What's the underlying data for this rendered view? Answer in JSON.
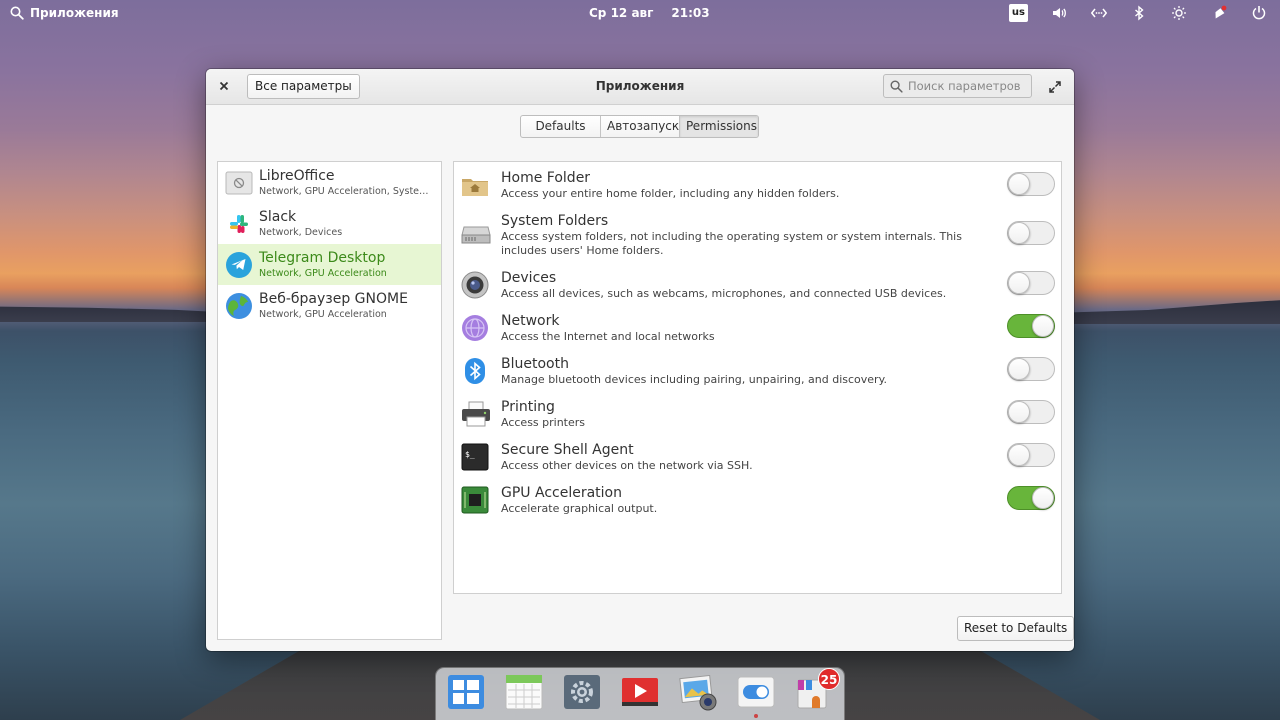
{
  "top_panel": {
    "apps_label": "Приложения",
    "date": "Ср 12 авг",
    "time": "21:03",
    "keyboard_layout": "us"
  },
  "window": {
    "title": "Приложения",
    "all_settings_label": "Все параметры",
    "search_placeholder": "Поиск параметров",
    "tabs": [
      {
        "label": "Defaults",
        "active": false
      },
      {
        "label": "Автозапуск",
        "active": false
      },
      {
        "label": "Permissions",
        "active": true
      }
    ],
    "apps": [
      {
        "name": "LibreOffice",
        "sub": "Network, GPU Acceleration, System Folders",
        "icon": "libreoffice-icon",
        "selected": false
      },
      {
        "name": "Slack",
        "sub": "Network, Devices",
        "icon": "slack-icon",
        "selected": false
      },
      {
        "name": "Telegram Desktop",
        "sub": "Network, GPU Acceleration",
        "icon": "telegram-icon",
        "selected": true
      },
      {
        "name": "Веб-браузер GNOME",
        "sub": "Network, GPU Acceleration",
        "icon": "gnome-web-icon",
        "selected": false
      }
    ],
    "permissions": [
      {
        "title": "Home Folder",
        "desc": "Access your entire home folder, including any hidden folders.",
        "icon": "home-folder-icon",
        "enabled": false
      },
      {
        "title": "System Folders",
        "desc": "Access system folders, not including the operating system or system internals. This includes users' Home folders.",
        "icon": "hard-drive-icon",
        "enabled": false
      },
      {
        "title": "Devices",
        "desc": "Access all devices, such as webcams, microphones, and connected USB devices.",
        "icon": "webcam-icon",
        "enabled": false
      },
      {
        "title": "Network",
        "desc": "Access the Internet and local networks",
        "icon": "network-icon",
        "enabled": true
      },
      {
        "title": "Bluetooth",
        "desc": "Manage bluetooth devices including pairing, unpairing, and discovery.",
        "icon": "bluetooth-icon",
        "enabled": false
      },
      {
        "title": "Printing",
        "desc": "Access printers",
        "icon": "printer-icon",
        "enabled": false
      },
      {
        "title": "Secure Shell Agent",
        "desc": "Access other devices on the network via SSH.",
        "icon": "terminal-icon",
        "enabled": false
      },
      {
        "title": "GPU Acceleration",
        "desc": "Accelerate graphical output.",
        "icon": "gpu-chip-icon",
        "enabled": true
      }
    ],
    "reset_label": "Reset to Defaults"
  },
  "dock": {
    "items": [
      "multitasking-view-icon",
      "calendar-icon",
      "system-settings-icon",
      "videos-icon",
      "photos-icon",
      "switchboard-toggle-icon",
      "appcenter-icon"
    ],
    "appcenter_badge": "25"
  },
  "colors": {
    "accent_green": "#68b53b",
    "selected_row": "#e7f6d3",
    "selected_text": "#3c8a1a"
  }
}
